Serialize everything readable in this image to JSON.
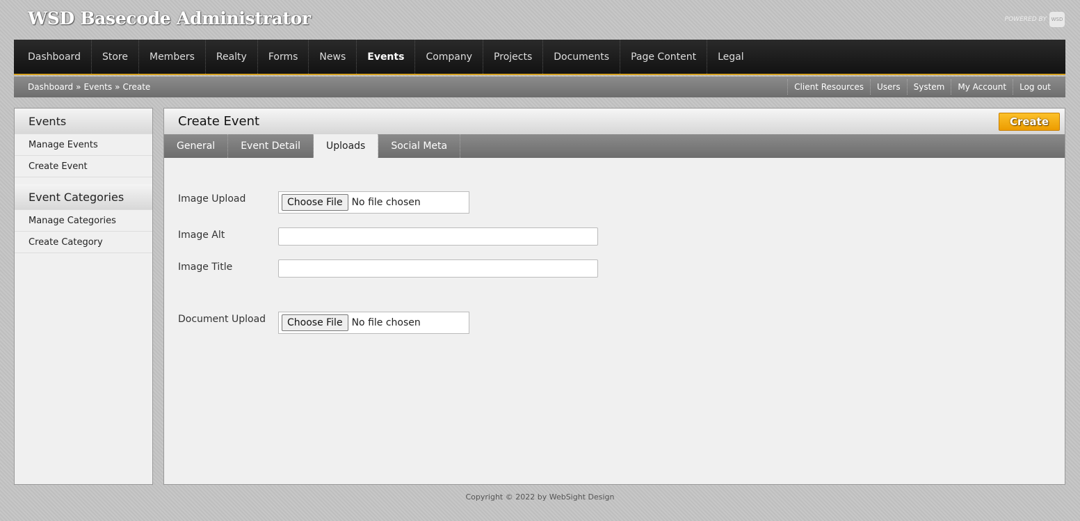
{
  "app": {
    "title": "WSD Basecode Administrator",
    "powered_by": "POWERED BY",
    "logo_text": "WSD"
  },
  "nav": {
    "items": [
      "Dashboard",
      "Store",
      "Members",
      "Realty",
      "Forms",
      "News",
      "Events",
      "Company",
      "Projects",
      "Documents",
      "Page Content",
      "Legal"
    ],
    "active": "Events"
  },
  "breadcrumb": [
    "Dashboard",
    "»",
    "Events",
    "»",
    "Create"
  ],
  "util_links": [
    "Client Resources",
    "Users",
    "System",
    "My Account",
    "Log out"
  ],
  "sidebar": {
    "sections": [
      {
        "title": "Events",
        "items": [
          "Manage Events",
          "Create Event"
        ]
      },
      {
        "title": "Event Categories",
        "items": [
          "Manage Categories",
          "Create Category"
        ]
      }
    ]
  },
  "main": {
    "title": "Create Event",
    "create_button": "Create",
    "tabs": [
      "General",
      "Event Detail",
      "Uploads",
      "Social Meta"
    ],
    "active_tab": "Uploads",
    "form": {
      "image_upload_label": "Image Upload",
      "image_alt_label": "Image Alt",
      "image_title_label": "Image Title",
      "document_upload_label": "Document Upload",
      "choose_file": "Choose File",
      "no_file": "No file chosen",
      "image_alt_value": "",
      "image_title_value": ""
    }
  },
  "footer": "Copyright © 2022 by WebSight Design"
}
